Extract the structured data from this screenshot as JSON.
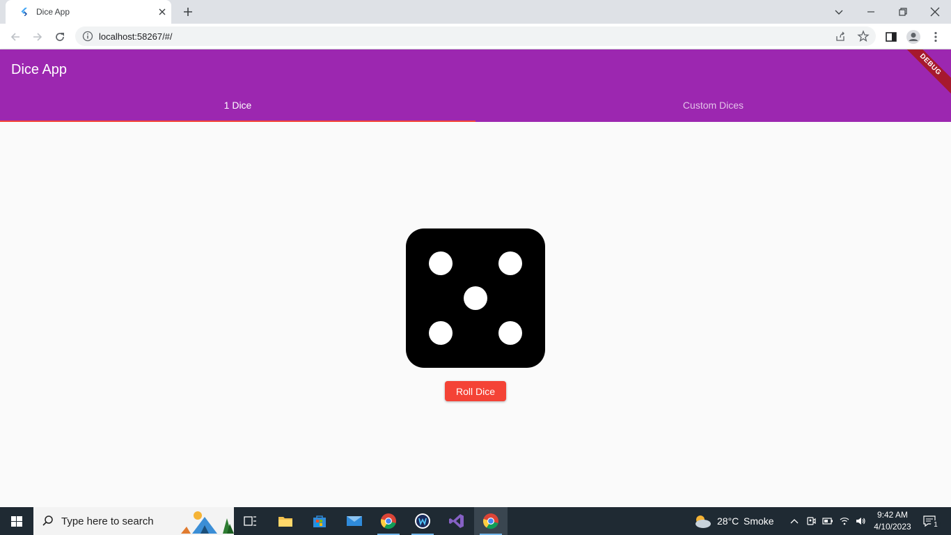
{
  "browser": {
    "tab_title": "Dice App",
    "url": "localhost:58267/#/"
  },
  "app": {
    "title": "Dice App",
    "tabs": [
      {
        "label": "1 Dice",
        "selected": true
      },
      {
        "label": "Custom Dices",
        "selected": false
      }
    ],
    "debug_banner": "DEBUG",
    "dice_value": 5,
    "roll_button_label": "Roll Dice",
    "colors": {
      "appbar": "#9c27b0",
      "indicator": "#f44336",
      "button": "#f44336",
      "dice": "#000000"
    }
  },
  "taskbar": {
    "search_placeholder": "Type here to search",
    "weather_temp": "28°C",
    "weather_desc": "Smoke",
    "time": "9:42 AM",
    "date": "4/10/2023",
    "notification_count": "1",
    "apps": [
      "task-view-icon",
      "file-explorer-icon",
      "store-icon",
      "mail-icon",
      "chrome-icon",
      "app-w-icon",
      "visual-studio-icon",
      "chrome-icon"
    ]
  }
}
